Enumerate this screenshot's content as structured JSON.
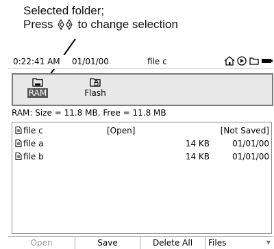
{
  "annotation": {
    "line1": "Selected folder;",
    "press": "Press",
    "rest": "to change selection"
  },
  "status_bar": {
    "time": "0:22:41 AM",
    "date": "01/01/00",
    "file": "file c",
    "icons": [
      "home-icon",
      "play-circle-icon",
      "folder-icon",
      "battery-icon"
    ]
  },
  "folders": [
    {
      "label": "RAM",
      "icon": "ram-folder-icon",
      "selected": true
    },
    {
      "label": "Flash",
      "icon": "flash-folder-icon",
      "selected": false
    }
  ],
  "memory_info": "RAM: Size = 11.8 MB, Free = 11.8 MB",
  "files": [
    {
      "name": "file c",
      "status": "[Open]",
      "size": "",
      "date": "[Not Saved]"
    },
    {
      "name": "file a",
      "status": "",
      "size": "14 KB",
      "date": "01/01/00"
    },
    {
      "name": "file b",
      "status": "",
      "size": "14 KB",
      "date": "01/01/00"
    }
  ],
  "softkeys": {
    "open": "Open",
    "save": "Save",
    "delete_all": "Delete All",
    "files": "Files"
  },
  "colors": {
    "selected_folder_bg": "#555555",
    "panel_bg": "#e8e8e8",
    "disabled_text": "#9a9a9a"
  }
}
